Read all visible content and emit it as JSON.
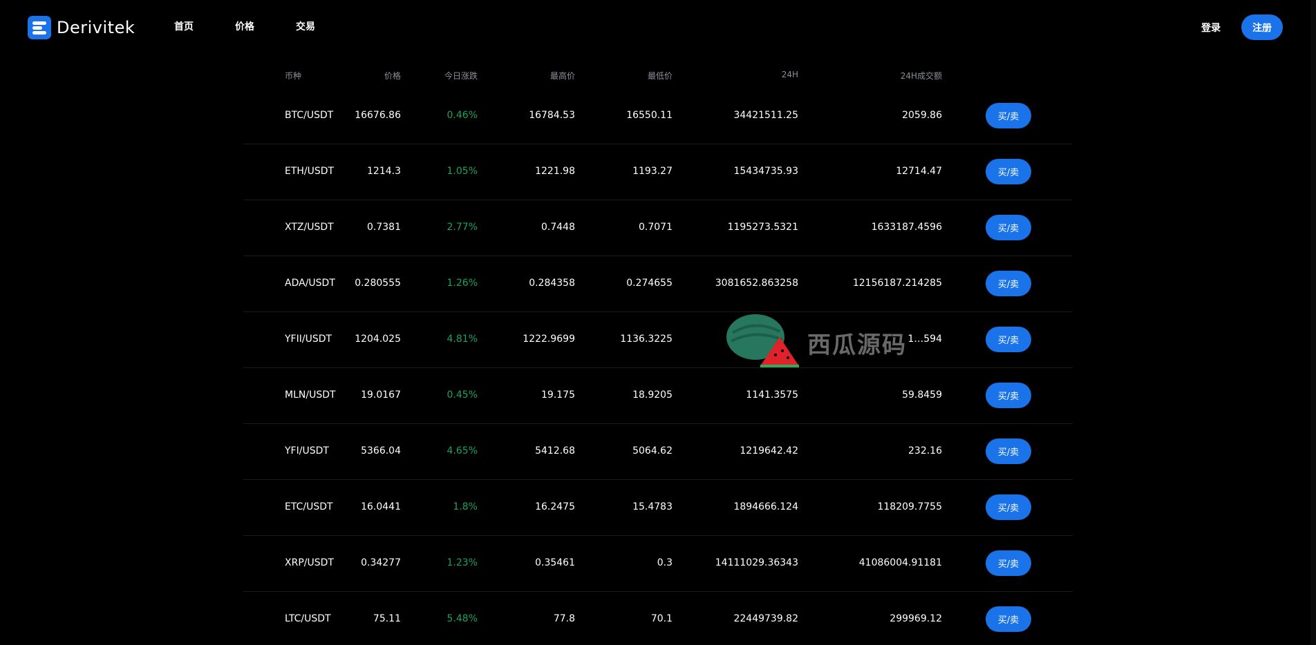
{
  "brand": {
    "name": "Derivitek",
    "accent_color": "#1a73e8",
    "up_color": "#1aa35f"
  },
  "nav": {
    "items": [
      {
        "label": "首页"
      },
      {
        "label": "价格"
      },
      {
        "label": "交易"
      }
    ]
  },
  "auth": {
    "login_label": "登录",
    "register_label": "注册"
  },
  "table": {
    "headers": [
      "币种",
      "价格",
      "今日涨跌",
      "最高价",
      "最低价",
      "24H",
      "24H成交额"
    ],
    "rows": [
      {
        "pair": "BTC/USDT",
        "price": "16676.86",
        "change": "0.46%",
        "high": "16784.53",
        "low": "16550.11",
        "vol24h": "34421511.25",
        "amount24h": "2059.86",
        "action": "买/卖"
      },
      {
        "pair": "ETH/USDT",
        "price": "1214.3",
        "change": "1.05%",
        "high": "1221.98",
        "low": "1193.27",
        "vol24h": "15434735.93",
        "amount24h": "12714.47",
        "action": "买/卖"
      },
      {
        "pair": "XTZ/USDT",
        "price": "0.7381",
        "change": "2.77%",
        "high": "0.7448",
        "low": "0.7071",
        "vol24h": "1195273.5321",
        "amount24h": "1633187.4596",
        "action": "买/卖"
      },
      {
        "pair": "ADA/USDT",
        "price": "0.280555",
        "change": "1.26%",
        "high": "0.284358",
        "low": "0.274655",
        "vol24h": "3081652.863258",
        "amount24h": "12156187.214285",
        "action": "买/卖"
      },
      {
        "pair": "YFII/USDT",
        "price": "1204.025",
        "change": "4.81%",
        "high": "1222.9699",
        "low": "1136.3225",
        "vol24h": "",
        "amount24h": "1…594",
        "action": "买/卖"
      },
      {
        "pair": "MLN/USDT",
        "price": "19.0167",
        "change": "0.45%",
        "high": "19.175",
        "low": "18.9205",
        "vol24h": "1141.3575",
        "amount24h": "59.8459",
        "action": "买/卖"
      },
      {
        "pair": "YFI/USDT",
        "price": "5366.04",
        "change": "4.65%",
        "high": "5412.68",
        "low": "5064.62",
        "vol24h": "1219642.42",
        "amount24h": "232.16",
        "action": "买/卖"
      },
      {
        "pair": "ETC/USDT",
        "price": "16.0441",
        "change": "1.8%",
        "high": "16.2475",
        "low": "15.4783",
        "vol24h": "1894666.124",
        "amount24h": "118209.7755",
        "action": "买/卖"
      },
      {
        "pair": "XRP/USDT",
        "price": "0.34277",
        "change": "1.23%",
        "high": "0.35461",
        "low": "0.3",
        "vol24h": "14111029.36343",
        "amount24h": "41086004.91181",
        "action": "买/卖"
      },
      {
        "pair": "LTC/USDT",
        "price": "75.11",
        "change": "5.48%",
        "high": "77.8",
        "low": "70.1",
        "vol24h": "22449739.82",
        "amount24h": "299969.12",
        "action": "买/卖"
      }
    ]
  },
  "watermark": {
    "text": "西瓜源码",
    "icon": "watermelon-icon"
  }
}
